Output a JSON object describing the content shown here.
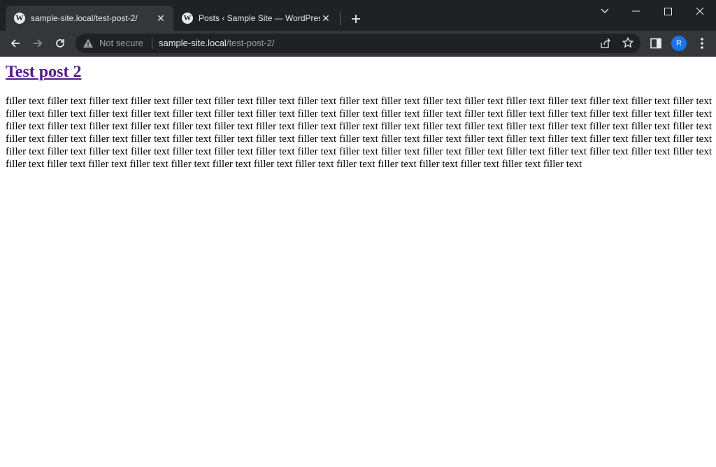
{
  "browser": {
    "tabs": [
      {
        "title": "sample-site.local/test-post-2/",
        "active": true,
        "icon": "wordpress-icon"
      },
      {
        "title": "Posts ‹ Sample Site — WordPress",
        "active": false,
        "icon": "wordpress-icon"
      }
    ],
    "new_tab_icon": "plus-icon",
    "avatar_initial": "R",
    "colors": {
      "tabstrip": "#202124",
      "toolbar": "#35363a",
      "omnibox": "#202124",
      "avatar": "#1a73e8",
      "visited_link": "#551a8b"
    }
  },
  "address_bar": {
    "security_label": "Not secure",
    "url_host": "sample-site.local",
    "url_path": "/test-post-2/"
  },
  "post": {
    "title": "Test post 2",
    "body": "filler text filler text filler text filler text filler text filler text filler text filler text filler text filler text filler text filler text filler text filler text filler text filler text filler text filler text filler text filler text filler text filler text filler text filler text filler text filler text filler text filler text filler text filler text filler text filler text filler text filler text filler text filler text filler text filler text filler text filler text filler text filler text filler text filler text filler text filler text filler text filler text filler text filler text filler text filler text filler text filler text filler text filler text filler text filler text filler text filler text filler text filler text filler text filler text filler text filler text filler text filler text filler text filler text filler text filler text filler text filler text filler text filler text filler text filler text filler text filler text filler text filler text filler text filler text filler text filler text filler text filler text filler text filler text filler text filler text filler text filler text filler text filler text filler text filler text filler text"
  }
}
